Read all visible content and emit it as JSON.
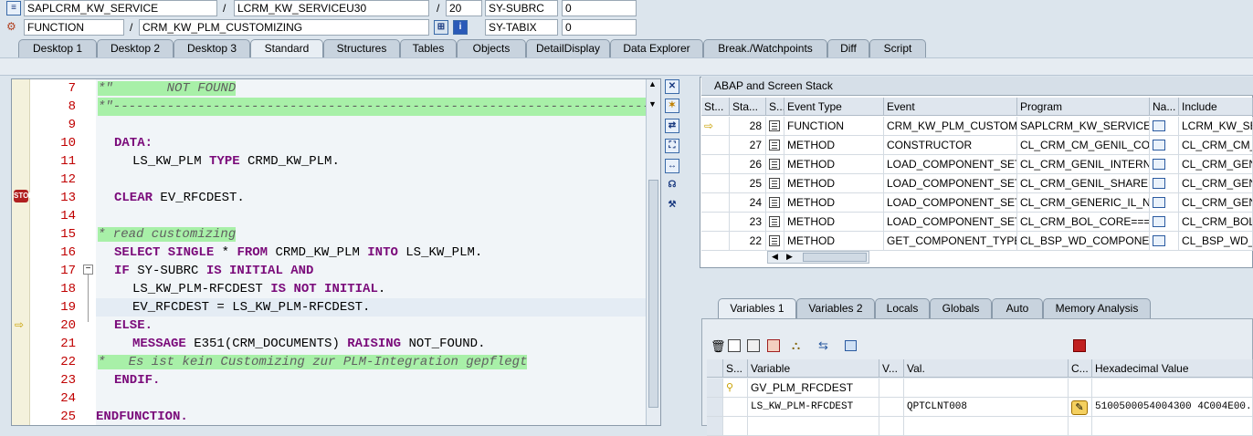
{
  "header": {
    "row1": {
      "program": "SAPLCRM_KW_SERVICE",
      "sep1": "/",
      "include": "LCRM_KW_SERVICEU30",
      "sep2": "/",
      "line": "20",
      "var": "SY-SUBRC",
      "val": "0"
    },
    "row2": {
      "type": "FUNCTION",
      "sep1": "/",
      "name": "CRM_KW_PLM_CUSTOMIZING",
      "var": "SY-TABIX",
      "val": "0"
    }
  },
  "tabs": [
    "Desktop 1",
    "Desktop 2",
    "Desktop 3",
    "Standard",
    "Structures",
    "Tables",
    "Objects",
    "DetailDisplay",
    "Data Explorer",
    "Break./Watchpoints",
    "Diff",
    "Script"
  ],
  "code": {
    "lines": [
      {
        "n": "7",
        "text": "*\"       NOT FOUND"
      },
      {
        "n": "8",
        "text": "*\"----------------------------------------------------------------------"
      },
      {
        "n": "9",
        "text": ""
      },
      {
        "n": "10",
        "text": "DATA:"
      },
      {
        "n": "11",
        "text": "LS_KW_PLM TYPE CRMD_KW_PLM."
      },
      {
        "n": "12",
        "text": ""
      },
      {
        "n": "13",
        "text": "CLEAR EV_RFCDEST."
      },
      {
        "n": "14",
        "text": ""
      },
      {
        "n": "15",
        "text": "* read customizing"
      },
      {
        "n": "16",
        "text": "SELECT SINGLE * FROM CRMD_KW_PLM INTO LS_KW_PLM."
      },
      {
        "n": "17",
        "text": "IF SY-SUBRC IS INITIAL AND"
      },
      {
        "n": "18",
        "text": "LS_KW_PLM-RFCDEST IS NOT INITIAL."
      },
      {
        "n": "19",
        "text": "EV_RFCDEST = LS_KW_PLM-RFCDEST."
      },
      {
        "n": "20",
        "text": "ELSE."
      },
      {
        "n": "21",
        "text": "MESSAGE E351(CRM_DOCUMENTS) RAISING NOT_FOUND."
      },
      {
        "n": "22",
        "text": "*   Es ist kein Customizing zur PLM-Integration gepflegt"
      },
      {
        "n": "23",
        "text": "ENDIF."
      },
      {
        "n": "24",
        "text": ""
      },
      {
        "n": "25",
        "text": "ENDFUNCTION."
      }
    ]
  },
  "stack": {
    "title": "ABAP and Screen Stack",
    "columns": [
      "St...",
      "Sta...",
      "S...",
      "Event Type",
      "Event",
      "Program",
      "Na...",
      "Include"
    ],
    "rows": [
      {
        "level": "28",
        "type": "FUNCTION",
        "event": "CRM_KW_PLM_CUSTOMI...",
        "program": "SAPLCRM_KW_SERVICE",
        "include": "LCRM_KW_SER"
      },
      {
        "level": "27",
        "type": "METHOD",
        "event": "CONSTRUCTOR",
        "program": "CL_CRM_CM_GENIL_COM...",
        "include": "CL_CRM_CM_G"
      },
      {
        "level": "26",
        "type": "METHOD",
        "event": "LOAD_COMPONENT_SET",
        "program": "CL_CRM_GENIL_INTERN...",
        "include": "CL_CRM_GENIL"
      },
      {
        "level": "25",
        "type": "METHOD",
        "event": "LOAD_COMPONENT_SET",
        "program": "CL_CRM_GENIL_SHARED...",
        "include": "CL_CRM_GENIL"
      },
      {
        "level": "24",
        "type": "METHOD",
        "event": "LOAD_COMPONENT_SET",
        "program": "CL_CRM_GENERIC_IL_NE...",
        "include": "CL_CRM_GENE"
      },
      {
        "level": "23",
        "type": "METHOD",
        "event": "LOAD_COMPONENT_SET",
        "program": "CL_CRM_BOL_CORE===...",
        "include": "CL_CRM_BOL_"
      },
      {
        "level": "22",
        "type": "METHOD",
        "event": "GET_COMPONENT_TYPE",
        "program": "CL_BSP_WD_COMPONE...",
        "include": "CL_BSP_WD_C"
      }
    ]
  },
  "vartabs": [
    "Variables 1",
    "Variables 2",
    "Locals",
    "Globals",
    "Auto",
    "Memory Analysis"
  ],
  "vars": {
    "columns": [
      "S...",
      "Variable",
      "V...",
      "Val.",
      "C...",
      "Hexadecimal Value"
    ],
    "rows": [
      {
        "name": "GV_PLM_RFCDEST",
        "val": "",
        "hex": ""
      },
      {
        "name": "LS_KW_PLM-RFCDEST",
        "val": "QPTCLNT008",
        "hex": "5100500054004300 4C004E00..."
      }
    ]
  },
  "colors": {
    "keyword": "#7a0a7a",
    "comment_bg": "#a8f0a8",
    "line_number": "#c00000",
    "background": "#dce5ed"
  }
}
